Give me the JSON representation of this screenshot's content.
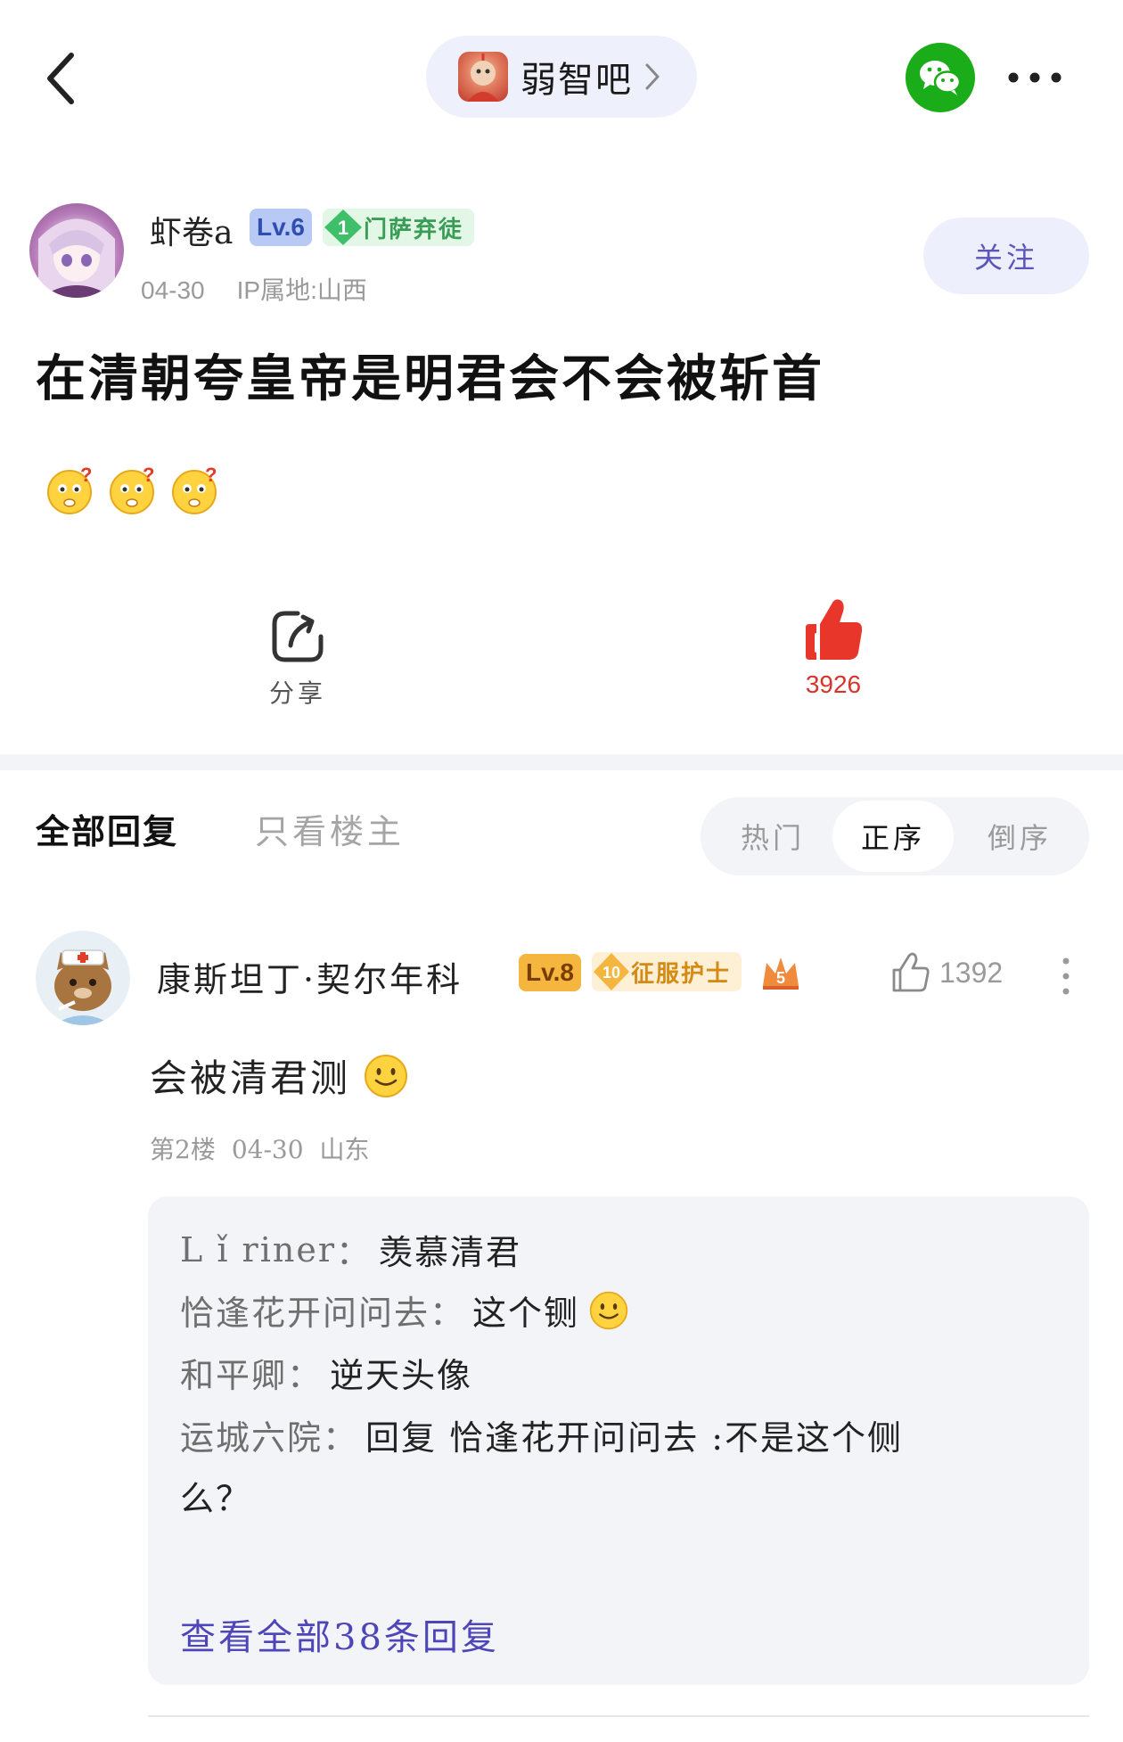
{
  "header": {
    "forum_name": "弱智吧",
    "icons": {
      "back": "chevron-left-icon",
      "forward": "chevron-right-icon",
      "share": "wechat-icon",
      "more": "more-dots-icon"
    },
    "wechat_color": "#1aad19"
  },
  "post": {
    "author": {
      "name": "虾卷a",
      "level": "Lv.6",
      "honor_rank": "1",
      "honor_title": "门萨弃徒"
    },
    "date": "04-30",
    "ip_location": "IP属地:山西",
    "follow_label": "关注",
    "title": "在清朝夸皇帝是明君会不会被斩首",
    "emojis": [
      "question-face-emoji",
      "question-face-emoji",
      "question-face-emoji"
    ],
    "actions": {
      "share_label": "分享",
      "like_count": "3926"
    }
  },
  "replies": {
    "tab_all": "全部回复",
    "tab_op_only": "只看楼主",
    "sort": {
      "hot": "热门",
      "asc": "正序",
      "desc": "倒序",
      "selected": "正序"
    }
  },
  "comment": {
    "author": {
      "name": "康斯坦丁·契尔年科",
      "level": "Lv.8",
      "honor_rank": "10",
      "honor_title": "征服护士",
      "crown_rank": "5"
    },
    "like_count": "1392",
    "text": "会被清君测",
    "floor": "第2楼",
    "date": "04-30",
    "location": "山东",
    "sub_replies": [
      {
        "name": "L ǐ riner",
        "text": "羡慕清君"
      },
      {
        "name": "恰逢花开问问去",
        "text": "这个铡"
      },
      {
        "name": "和平卿",
        "text": "逆天头像"
      },
      {
        "name": "运城六院",
        "text": "回复 恰逢花开问问去 :不是这个侧"
      },
      {
        "name": "",
        "text": "么？"
      }
    ],
    "view_all": "查看全部38条回复"
  },
  "colors": {
    "accent_purple": "#4e46b8",
    "like_red": "#d9342b",
    "level6_bg": "#b8c9f5",
    "level8_bg": "#f5b640"
  }
}
